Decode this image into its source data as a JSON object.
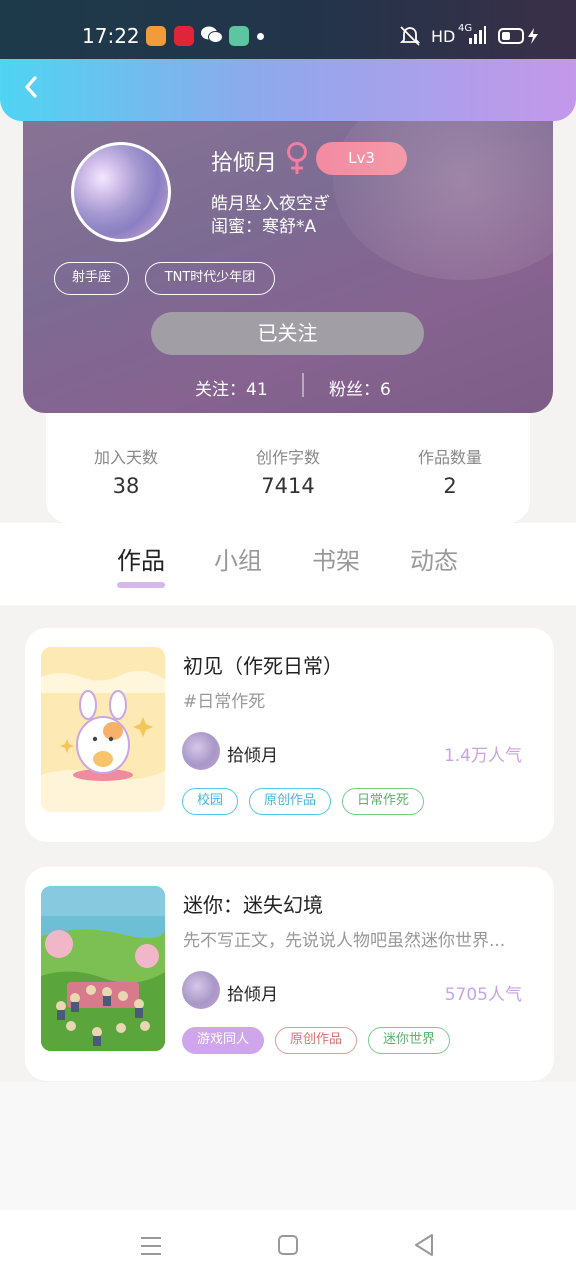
{
  "status_bar": {
    "time": "17:22",
    "hd": "HD",
    "network": "4G"
  },
  "colors": {
    "accent": "#d6b8ea",
    "popularity": "#c9a4e5",
    "level_badge": "#f38aa2",
    "follow_button": "#a19fa5"
  },
  "profile": {
    "name": "拾倾月",
    "level": "Lv3",
    "signature": "皓月坠入夜空ぎ",
    "bestie": "闺蜜：寒舒*A",
    "tags": [
      "射手座",
      "TNT时代少年团"
    ],
    "follow_button": "已关注",
    "following": "关注：41",
    "fans": "粉丝：6"
  },
  "stats": [
    {
      "label": "加入天数",
      "value": "38"
    },
    {
      "label": "创作字数",
      "value": "7414"
    },
    {
      "label": "作品数量",
      "value": "2"
    }
  ],
  "tabs": [
    "作品",
    "小组",
    "书架",
    "动态"
  ],
  "active_tab": "作品",
  "works": [
    {
      "title": "初见（作死日常）",
      "desc": "#日常作死",
      "author": "拾倾月",
      "popularity": "1.4万人气",
      "tags": [
        "校园",
        "原创作品",
        "日常作死"
      ]
    },
    {
      "title": "迷你：迷失幻境",
      "desc": "先不写正文，先说说人物吧虽然迷你世界...",
      "author": "拾倾月",
      "popularity": "5705人气",
      "tags": [
        "游戏同人",
        "原创作品",
        "迷你世界"
      ]
    }
  ]
}
